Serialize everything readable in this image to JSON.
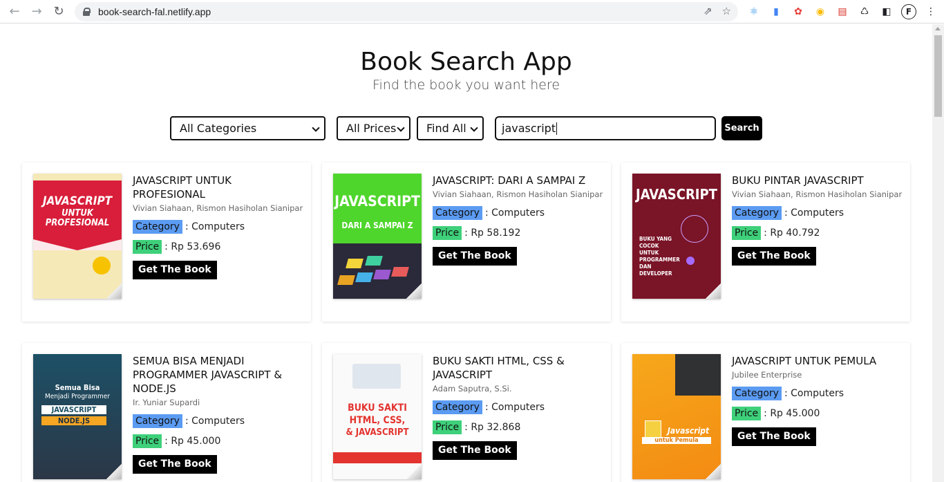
{
  "browser": {
    "url": "book-search-fal.netlify.app",
    "profile_initial": "F"
  },
  "header": {
    "title": "Book Search App",
    "subtitle": "Find the book you want here"
  },
  "filters": {
    "category": "All Categories",
    "price": "All Prices",
    "find": "Find All",
    "query": "javascript",
    "search_label": "Search"
  },
  "labels": {
    "category": "Category",
    "price": "Price",
    "get_book": "Get The Book"
  },
  "books": [
    {
      "title": "JAVASCRIPT UNTUK PROFESIONAL",
      "author": "Vivian Siahaan, Rismon Hasiholan Sianipar",
      "category": ": Computers",
      "price": ": Rp 53.696",
      "cover_text": [
        "JAVASCRIPT",
        "UNTUK",
        "PROFESIONAL"
      ]
    },
    {
      "title": "JAVASCRIPT: DARI A SAMPAI Z",
      "author": "Vivian Siahaan, Rismon Hasiholan Sianipar",
      "category": ": Computers",
      "price": ": Rp 58.192",
      "cover_text": [
        "JAVASCRIPT",
        "DARI A SAMPAI Z"
      ]
    },
    {
      "title": "BUKU PINTAR JAVASCRIPT",
      "author": "Vivian Siahaan, Rismon Hasiholan Sianipar",
      "category": ": Computers",
      "price": ": Rp 40.792",
      "cover_text": [
        "JAVASCRIPT",
        "BUKU YANG COCOK UNTUK PROGRAMMER DAN DEVELOPER"
      ]
    },
    {
      "title": "SEMUA BISA MENJADI PROGRAMMER JAVASCRIPT & NODE.JS",
      "author": "Ir. Yuniar Supardi",
      "category": ": Computers",
      "price": ": Rp 45.000",
      "cover_text": [
        "Semua Bisa",
        "Menjadi Programmer",
        "JAVASCRIPT",
        "NODE.JS"
      ]
    },
    {
      "title": "BUKU SAKTI HTML, CSS & JAVASCRIPT",
      "author": "Adam Saputra, S.Si.",
      "category": ": Computers",
      "price": ": Rp 32.868",
      "cover_text": [
        "BUKU SAKTI",
        "HTML, CSS,",
        "& JAVASCRIPT"
      ]
    },
    {
      "title": "JAVASCRIPT UNTUK PEMULA",
      "author": "Jubilee Enterprise",
      "category": ": Computers",
      "price": ": Rp 45.000",
      "cover_text": [
        "Javascript",
        "untuk Pemula"
      ]
    }
  ]
}
